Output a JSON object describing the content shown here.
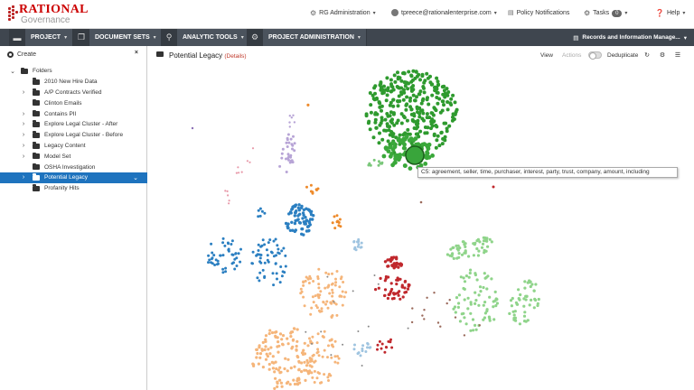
{
  "brand": {
    "name_top": "RATIONAL",
    "name_bottom": "Governance"
  },
  "topnav": {
    "admin": "RG Administration",
    "user": "tpreece@rationalenterprise.com",
    "notifications": "Policy Notifications",
    "tasks": "Tasks",
    "tasks_count": "0",
    "help": "Help"
  },
  "menu": {
    "project": "PROJECT",
    "document_sets": "DOCUMENT SETS",
    "analytic_tools": "ANALYTIC TOOLS",
    "project_administration": "PROJECT ADMINISTRATION",
    "records": "Records and Information Manage..."
  },
  "sidebar": {
    "create": "Create",
    "close": "×",
    "root": "Folders",
    "items": [
      {
        "label": "2010 New Hire Data",
        "expandable": false
      },
      {
        "label": "A/P Contracts Verified",
        "expandable": true
      },
      {
        "label": "Clinton Emails",
        "expandable": false
      },
      {
        "label": "Contains PII",
        "expandable": true
      },
      {
        "label": "Explore Legal Cluster - After",
        "expandable": true
      },
      {
        "label": "Explore Legal Cluster - Before",
        "expandable": true
      },
      {
        "label": "Legacy Content",
        "expandable": true
      },
      {
        "label": "Model Set",
        "expandable": true
      },
      {
        "label": "OSHA Investigation",
        "expandable": false
      },
      {
        "label": "Potential Legacy",
        "expandable": true,
        "selected": true
      },
      {
        "label": "Profanity Hits",
        "expandable": false
      }
    ]
  },
  "main": {
    "title": "Potential Legacy",
    "details": "(Details)",
    "view": "View",
    "actions": "Actions",
    "deduplicate": "Deduplicate"
  },
  "tooltip": "C5: agreement, seller, time, purchaser, interest, party, trust, company, amount, including",
  "colors": {
    "accent": "#1e73be",
    "menubar": "#3f464f",
    "details": "#c0392b",
    "cluster_green_dark": "#2e9a2e",
    "cluster_green_light": "#8fd48a",
    "cluster_blue": "#2b7fc1",
    "cluster_light_blue": "#9fc4e0",
    "cluster_orange": "#f5b57a",
    "cluster_dark_orange": "#ee8a2a",
    "cluster_red": "#c0282d",
    "cluster_purple": "#b7a4d6",
    "cluster_pink": "#e89aaa",
    "cluster_brown": "#9b6a5c"
  }
}
